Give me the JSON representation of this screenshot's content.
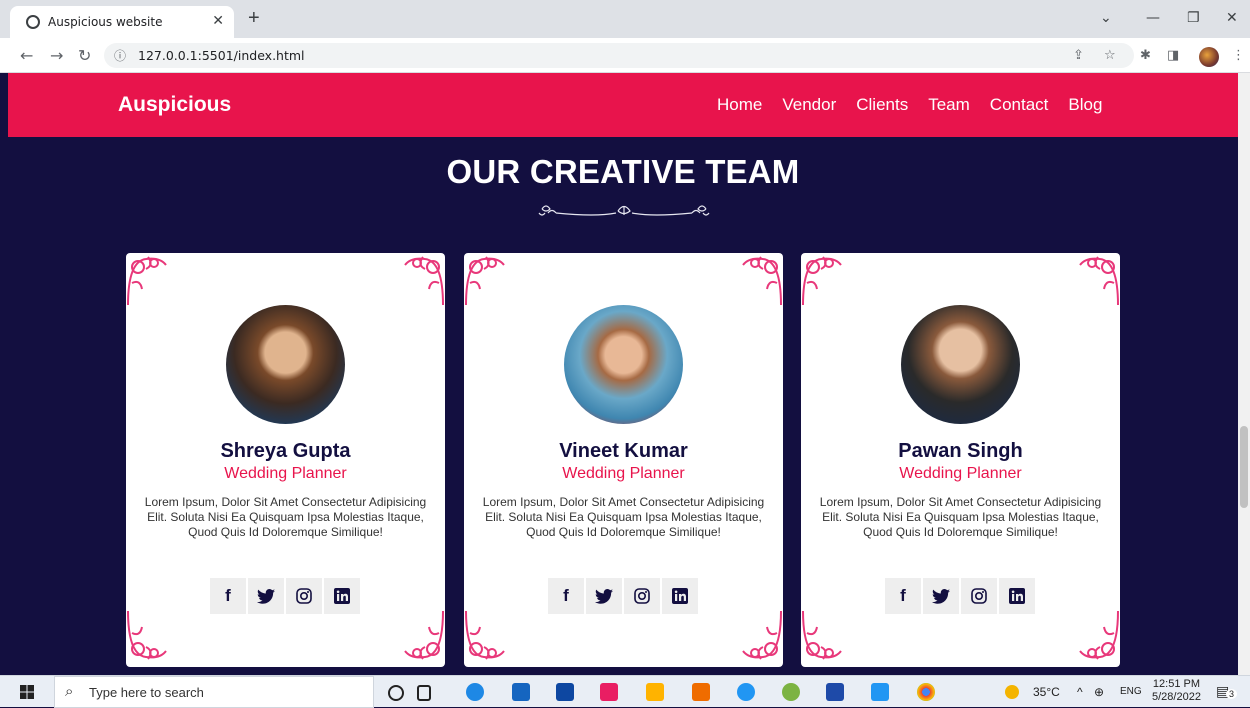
{
  "browser": {
    "tab_title": "Auspicious website",
    "tab_close": "✕",
    "new_tab": "+",
    "url": "127.0.0.1:5501/index.html",
    "minimize": "—",
    "restore": "❐",
    "close": "✕"
  },
  "site": {
    "logo": "Auspicious",
    "nav": [
      "Home",
      "Vendor",
      "Clients",
      "Team",
      "Contact",
      "Blog"
    ],
    "accent_color": "#e8144c",
    "background_color": "#130f40"
  },
  "section": {
    "title": "OUR CREATIVE TEAM"
  },
  "team": [
    {
      "name": "Shreya Gupta",
      "role": "Wedding Planner",
      "description": "Lorem Ipsum, Dolor Sit Amet Consectetur Adipisicing Elit. Soluta Nisi Ea Quisquam Ipsa Molestias Itaque, Quod Quis Id Doloremque Similique!"
    },
    {
      "name": "Vineet Kumar",
      "role": "Wedding Planner",
      "description": "Lorem Ipsum, Dolor Sit Amet Consectetur Adipisicing Elit. Soluta Nisi Ea Quisquam Ipsa Molestias Itaque, Quod Quis Id Doloremque Similique!"
    },
    {
      "name": "Pawan Singh",
      "role": "Wedding Planner",
      "description": "Lorem Ipsum, Dolor Sit Amet Consectetur Adipisicing Elit. Soluta Nisi Ea Quisquam Ipsa Molestias Itaque, Quod Quis Id Doloremque Similique!"
    }
  ],
  "social_icons": [
    "facebook-icon",
    "twitter-icon",
    "instagram-icon",
    "linkedin-icon"
  ],
  "taskbar": {
    "search_placeholder": "Type here to search",
    "weather": "35°C",
    "language": "ENG",
    "time": "12:51 PM",
    "date": "5/28/2022",
    "notification_count": "3"
  }
}
